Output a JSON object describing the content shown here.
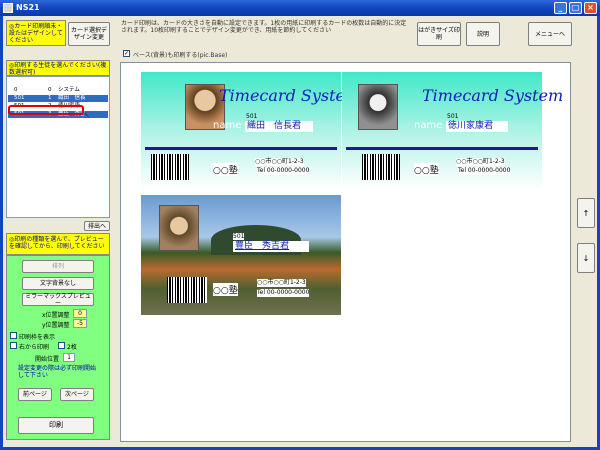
{
  "window": {
    "title": "NS21"
  },
  "top_left_note": "◎カード印刷順未・設たはデザインしてください",
  "card_design_button": "カード選択デザイン変更",
  "description": "カード印刷は、カードの大きさを自動に設定できます。1枚の用紙に印刷するカードの枚数は自動的に決定されます。10枚印刷することでデザイン変更ができ、用紙を節約してください",
  "btn_size_label": "はがきサイズ印刷",
  "btn_explain": "説明",
  "btn_menu": "メニューへ",
  "checkbox_base": "ベース(背景)も印刷する(pic.Base)",
  "student_note": "◎印刷する生徒を選んでください(複数選択可)",
  "list_rows": [
    {
      "c1": "0",
      "c2": "0",
      "c3": "システム",
      "selected": false
    },
    {
      "c1": "501",
      "c2": "1",
      "c3": "織田　信長",
      "selected": true
    },
    {
      "c1": "501",
      "c2": "2",
      "c3": "徳川家康",
      "selected": false
    },
    {
      "c1": "501",
      "c2": "3",
      "c3": "豊臣　秀吉",
      "selected": true
    }
  ],
  "btn_output": "排出へ",
  "format_note": "◎印刷の種類を選んで、プレビューを確認してから、印刷してください",
  "btn_format": "排列",
  "btn_no_text": "文字背景なし",
  "btn_mirror": "ミラーマックスプレビュー",
  "x_offset_label": "x位置調整",
  "x_offset_value": "0",
  "y_offset_label": "y位置調整",
  "y_offset_value": "-5",
  "chk_print_frame": "印刷枠を表示",
  "chk_right_print": "右から印刷",
  "chk_two_sheet": "2枚",
  "start_pos_label": "開始位置",
  "start_pos_value": "1",
  "warning_note": "設定変更の際は必ず印刷開始して下さい",
  "btn_prev": "前ページ",
  "btn_next": "次ページ",
  "btn_print": "印刷",
  "btn_up": "↑",
  "btn_down": "↓",
  "cards": [
    {
      "logo": "Timecard System",
      "class_num": "501",
      "name_label": "name",
      "name": "織田　信長君",
      "school": "○○塾",
      "address": "○○市○○町1-2-3",
      "tel": "Tel 00-0000-0000"
    },
    {
      "logo": "Timecard System",
      "class_num": "501",
      "name_label": "name",
      "name": "徳川家康君",
      "school": "○○塾",
      "address": "○○市○○町1-2-3",
      "tel": "Tel 00-0000-0000"
    },
    {
      "class_num": "501",
      "name": "豊臣　秀吉君",
      "school": "○○塾",
      "address": "○○市○○町1-2-3",
      "tel": "Tel 00-0000-0000"
    }
  ],
  "colors": {
    "title_bar": "#1046c0",
    "highlight": "#ffff00",
    "panel_green": "#80ff80",
    "card_cyan": "#40e0c0",
    "logo_blue": "#1020b0",
    "selected_row": "#316ac5",
    "red_mark": "#e00000"
  }
}
